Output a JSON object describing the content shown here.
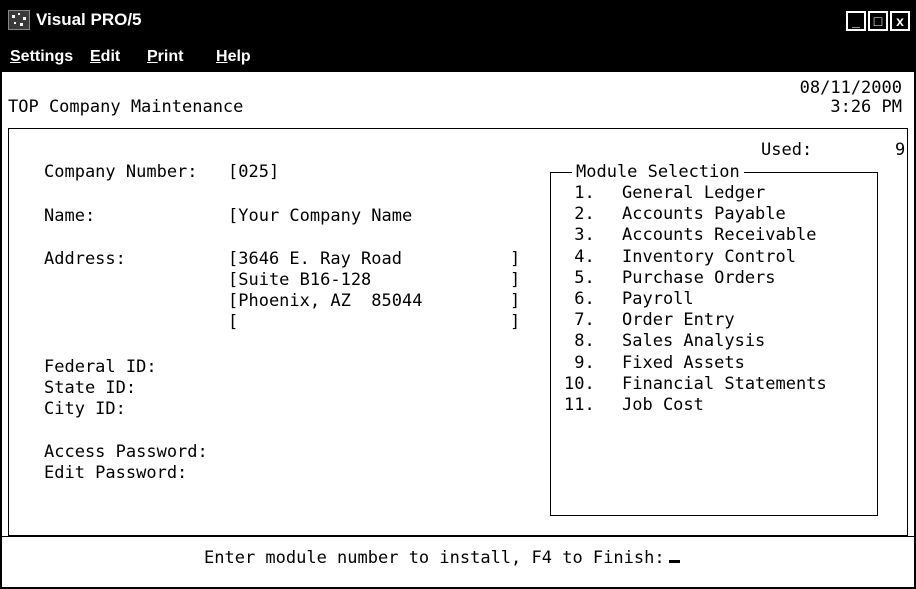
{
  "window": {
    "title": "Visual PRO/5",
    "controls": {
      "minimize": "_",
      "maximize": "□",
      "close": "x"
    }
  },
  "menu": [
    {
      "label": "Settings",
      "mnemonic": "S",
      "rest": "ettings"
    },
    {
      "label": "Edit",
      "mnemonic": "E",
      "rest": "dit"
    },
    {
      "label": "Print",
      "mnemonic": "P",
      "rest": "rint"
    },
    {
      "label": "Help",
      "mnemonic": "H",
      "rest": "elp"
    }
  ],
  "header": {
    "title": "TOP Company Maintenance",
    "date": "08/11/2000",
    "time": "3:26 PM"
  },
  "form": {
    "company_number_label": "Company Number:",
    "company_number_value": "[025]",
    "name_label": "Name:",
    "name_value": "[Your Company Name",
    "address_label": "Address:",
    "address_lines": [
      "[3646 E. Ray Road",
      "[Suite B16-128",
      "[Phoenix, AZ  85044",
      "["
    ],
    "bracket_close": "]",
    "federal_id_label": "Federal ID:",
    "state_id_label": "State ID:",
    "city_id_label": "City ID:",
    "access_password_label": "Access Password:",
    "edit_password_label": "Edit Password:"
  },
  "modules": {
    "used_label": "Used:",
    "used_value": "9",
    "title": "Module Selection",
    "items": [
      {
        "num": " 1.",
        "name": "General Ledger"
      },
      {
        "num": " 2.",
        "name": "Accounts Payable"
      },
      {
        "num": " 3.",
        "name": "Accounts Receivable"
      },
      {
        "num": " 4.",
        "name": "Inventory Control"
      },
      {
        "num": " 5.",
        "name": "Purchase Orders"
      },
      {
        "num": " 6.",
        "name": "Payroll"
      },
      {
        "num": " 7.",
        "name": "Order Entry"
      },
      {
        "num": " 8.",
        "name": "Sales Analysis"
      },
      {
        "num": " 9.",
        "name": "Fixed Assets"
      },
      {
        "num": "10.",
        "name": "Financial Statements"
      },
      {
        "num": "11.",
        "name": "Job Cost"
      }
    ]
  },
  "prompt": {
    "text": "Enter module number to install, F4 to Finish:"
  }
}
